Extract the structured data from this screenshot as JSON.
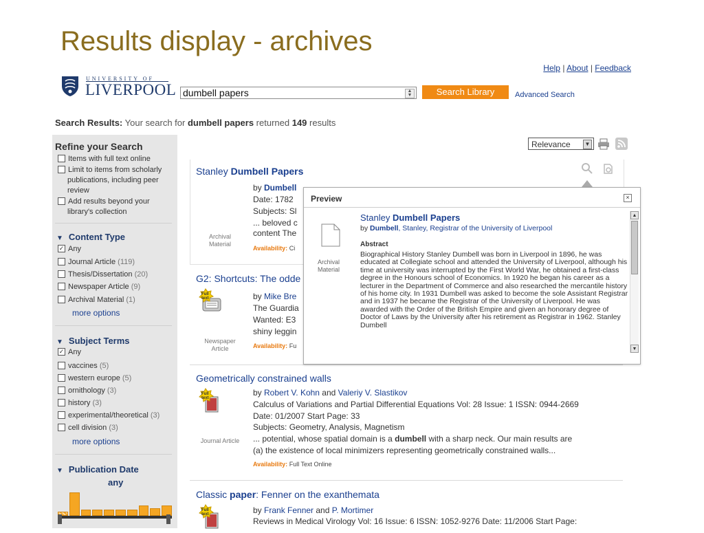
{
  "slide": {
    "title": "Results display - archives"
  },
  "header": {
    "links": {
      "help": "Help",
      "about": "About",
      "feedback": "Feedback",
      "sep": "|"
    },
    "logo": {
      "top": "UNIVERSITY OF",
      "name": "LIVERPOOL"
    }
  },
  "search": {
    "value": "dumbell papers",
    "button": "Search Library",
    "advanced": "Advanced Search"
  },
  "summary": {
    "label": "Search Results:",
    "pre": "Your search for",
    "query": "dumbell papers",
    "mid": "returned",
    "count": "149",
    "post": "results"
  },
  "sidebar": {
    "refine_title": "Refine your Search",
    "options": [
      {
        "label": "Items with full text online",
        "checked": false
      },
      {
        "label": "Limit to items from scholarly",
        "label2": "publications, including peer",
        "label3": "review",
        "checked": false
      },
      {
        "label": "Add results beyond your",
        "label2": "library's collection",
        "checked": false
      }
    ],
    "content_type": {
      "title": "Content Type",
      "items": [
        {
          "label": "Any",
          "count": "",
          "checked": true
        },
        {
          "label": "Journal Article",
          "count": "(119)",
          "checked": false
        },
        {
          "label": "Thesis/Dissertation",
          "count": "(20)",
          "checked": false
        },
        {
          "label": "Newspaper Article",
          "count": "(9)",
          "checked": false
        },
        {
          "label": "Archival Material",
          "count": "(1)",
          "checked": false
        }
      ],
      "more": "more options"
    },
    "subject_terms": {
      "title": "Subject Terms",
      "items": [
        {
          "label": "Any",
          "count": "",
          "checked": true
        },
        {
          "label": "vaccines",
          "count": "(5)",
          "checked": false
        },
        {
          "label": "western europe",
          "count": "(5)",
          "checked": false
        },
        {
          "label": "ornithology",
          "count": "(3)",
          "checked": false
        },
        {
          "label": "history",
          "count": "(3)",
          "checked": false
        },
        {
          "label": "experimental/theoretical",
          "count": "(3)",
          "checked": false
        },
        {
          "label": "cell division",
          "count": "(3)",
          "checked": false
        }
      ],
      "more": "more options"
    },
    "publication_date": {
      "title": "Publication Date",
      "value": "any",
      "bars": [
        0.15,
        0.9,
        0.25,
        0.25,
        0.25,
        0.25,
        0.25,
        0.4,
        0.3,
        0.4
      ]
    }
  },
  "toolbar": {
    "sort": "Relevance"
  },
  "results": [
    {
      "title_pre": "Stanley ",
      "title_bold": "Dumbell Papers",
      "title_post": "",
      "by": "by ",
      "author": "Dumbell",
      "author_rest": ", Stanley, Registrar of the University of Liverpool",
      "line2": "Date: 1782",
      "line3": "Subjects: Sl",
      "line4": "... beloved c",
      "line5": "content The",
      "type": "Archival Material",
      "avail_label": "Availability:",
      "avail_value": "Ci"
    },
    {
      "title_pre": "G2: Shortcuts: The odde",
      "title_bold": "",
      "title_post": "",
      "by": "by ",
      "author": "Mike Bre",
      "author_rest": "",
      "line2": "The Guardia",
      "line3": "Wanted: E3",
      "line4": "shiny leggin",
      "type": "Newspaper Article",
      "avail_label": "Availability:",
      "avail_value": "Fu"
    },
    {
      "title_pre": "Geometrically constrained walls",
      "title_bold": "",
      "title_post": "",
      "by": "by ",
      "author": "Robert V. Kohn",
      "and": " and ",
      "author2": "Valeriy V. Slastikov",
      "line2": "Calculus of Variations and Partial Differential Equations Vol: 28 Issue: 1 ISSN: 0944-2669",
      "line3": "Date: 01/2007 Start Page: 33",
      "line4": "Subjects: Geometry, Analysis, Magnetism",
      "line5_pre": "... potential, whose spatial domain is a ",
      "line5_bold": "dumbell",
      "line5_post": " with a sharp neck. Our main results are",
      "line6": "(a) the existence of local minimizers representing geometrically constrained walls...",
      "type": "Journal Article",
      "avail_label": "Availability:",
      "avail_value": "Full Text Online"
    },
    {
      "title_pre": "Classic ",
      "title_bold": "paper",
      "title_post": ": Fenner on the exanthemata",
      "by": "by ",
      "author": "Frank Fenner",
      "and": " and ",
      "author2": "P. Mortimer",
      "line2": "Reviews in Medical Virology Vol: 16 Issue: 6 ISSN: 1052-9276 Date: 11/2006 Start Page:"
    }
  ],
  "fulltext_badge": {
    "line1": "Full",
    "line2": "text"
  },
  "preview": {
    "title": "Preview",
    "close": "×",
    "item_title_pre": "Stanley ",
    "item_title_bold": "Dumbell Papers",
    "by_pre": "by ",
    "by_author": "Dumbell",
    "by_rest": ", Stanley, Registrar of the University of Liverpool",
    "type": "Archival Material",
    "abstract_label": "Abstract",
    "abstract": "Biographical History Stanley Dumbell was born in Liverpool in 1896, he was educated at Collegiate school and attended the University of Liverpool, although his time at university was interrupted by the First World War, he obtained a first-class degree in the Honours school of Economics. In 1920 he began his career as a lecturer in the Department of Commerce and also researched the mercantile history of his home city. In 1931 Dumbell was asked to become the sole Assistant Registrar and in 1937 he became the Registrar of the University of Liverpool. He was awarded with the Order of the British Empire and given an honorary degree of Doctor of Laws by the University after his retirement as Registrar in 1962. Stanley Dumbell"
  },
  "colors": {
    "accent": "#f08a14",
    "link": "#1a3f8f",
    "title": "#8a6d1f",
    "sidebar": "#e6e6e6"
  }
}
